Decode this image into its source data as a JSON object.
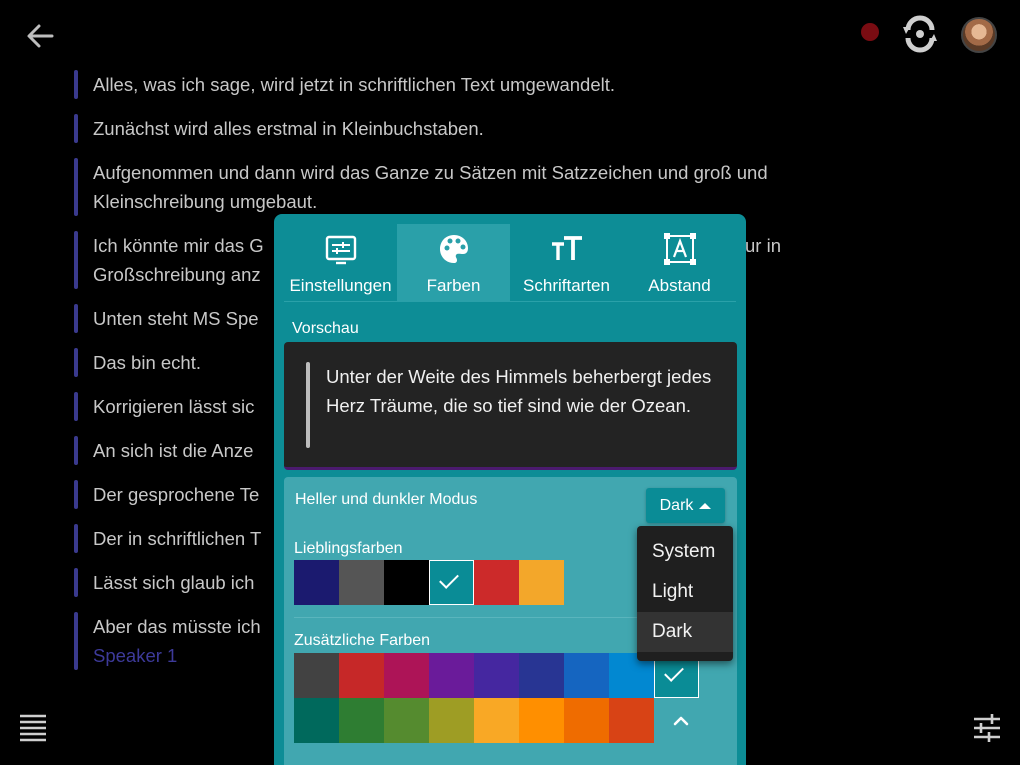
{
  "header": {
    "back_icon": "arrow-left-icon",
    "record_color": "#7a0c12",
    "sync_icon": "sync-icon"
  },
  "transcript": {
    "lines": [
      "Alles, was ich sage, wird jetzt in schriftlichen Text umgewandelt.",
      "Zunächst wird alles erstmal in Kleinbuchstaben.",
      "Aufgenommen und dann wird das Ganze zu Sätzen mit Satzzeichen und groß und Kleinschreibung umgebaut.",
      "Ich könnte mir das G",
      "ur in",
      "Großschreibung anz",
      "Unten steht MS Spe",
      "Das bin echt.",
      "Korrigieren lässt sic",
      "An sich ist die Anze",
      "Der gesprochene Te",
      "Der in schriftlichen T",
      "Lässt sich glaub ich",
      "Aber das müsste ich"
    ],
    "speaker": "Speaker 1"
  },
  "panel": {
    "tabs": [
      {
        "label": "Einstellungen",
        "icon": "settings-sliders-icon"
      },
      {
        "label": "Farben",
        "icon": "palette-icon"
      },
      {
        "label": "Schriftarten",
        "icon": "text-size-icon"
      },
      {
        "label": "Abstand",
        "icon": "spacing-icon"
      }
    ],
    "active_tab": "Farben",
    "preview_label": "Vorschau",
    "preview_text": "Unter der Weite des Himmels beherbergt jedes Herz Träume, die so tief sind wie der Ozean.",
    "mode_label": "Heller und dunkler Modus",
    "mode_value": "Dark",
    "favorites_label": "Lieblingsfarben",
    "favorites": [
      "#1b1a6f",
      "#555555",
      "#000000",
      "#0a8c96",
      "#cc2a2a",
      "#f3a72a"
    ],
    "favorites_selected": 3,
    "extra_label": "Zusätzliche Farben",
    "extra_row1": [
      "#424242",
      "#c62828",
      "#ad1457",
      "#6a1b9a",
      "#4527a0",
      "#283593",
      "#1565c0",
      "#0288d1",
      "#0a8c96"
    ],
    "extra_row1_selected": 8,
    "extra_row2": [
      "#00695c",
      "#2e7d32",
      "#558b2f",
      "#9e9d24",
      "#f9a825",
      "#ff8f00",
      "#ef6c00",
      "#d84315"
    ]
  },
  "mode_menu": {
    "options": [
      "System",
      "Light",
      "Dark"
    ],
    "selected": "Dark"
  }
}
